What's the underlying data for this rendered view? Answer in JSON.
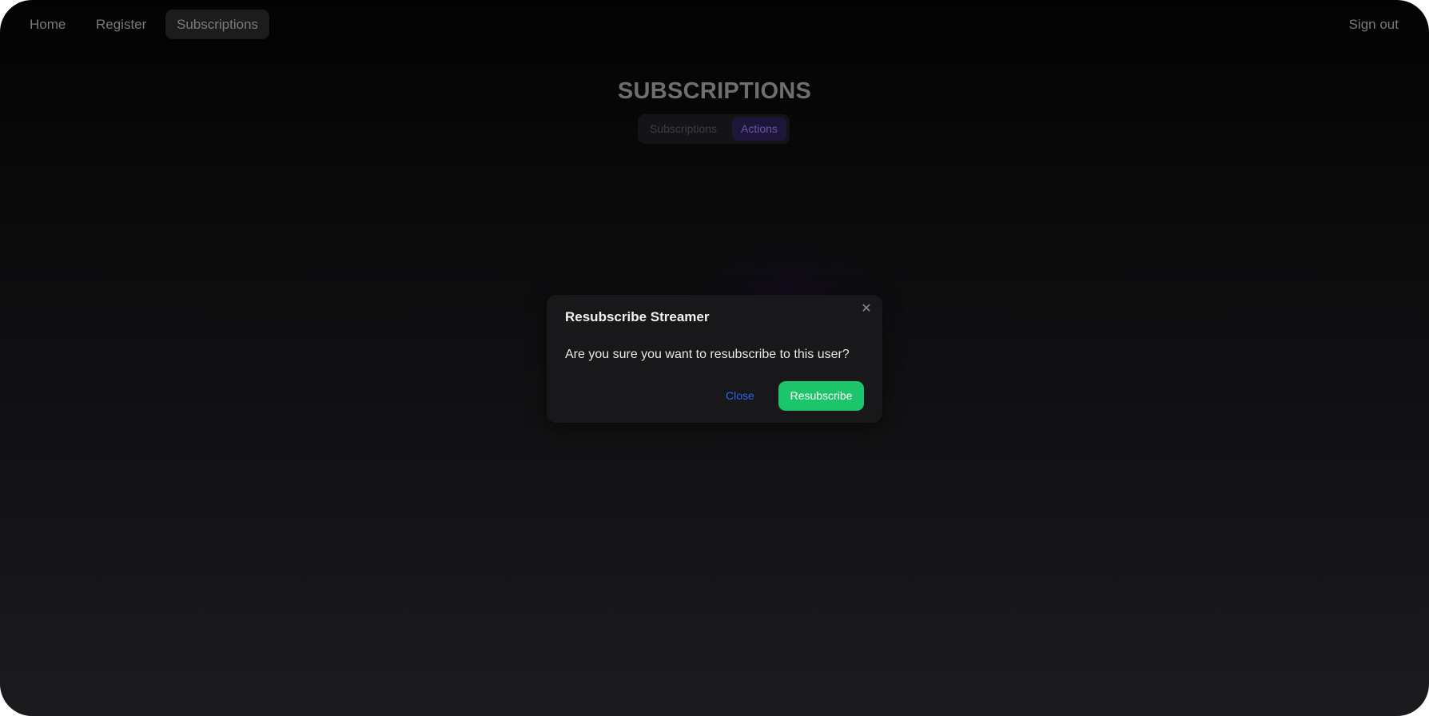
{
  "nav": {
    "home": "Home",
    "register": "Register",
    "subscriptions": "Subscriptions",
    "sign_out": "Sign out"
  },
  "page": {
    "title": "SUBSCRIPTIONS",
    "tabs": [
      {
        "label": "Subscriptions",
        "active": false
      },
      {
        "label": "Actions",
        "active": true
      }
    ]
  },
  "modal": {
    "title": "Resubscribe Streamer",
    "close_icon": "close-icon",
    "body": "Are you sure you want to resubscribe to this user?",
    "close_label": "Close",
    "confirm_label": "Resubscribe"
  },
  "colors": {
    "accent_purple": "#6a56a6",
    "confirm_green": "#1dc56a",
    "link_blue": "#2e63e6"
  }
}
